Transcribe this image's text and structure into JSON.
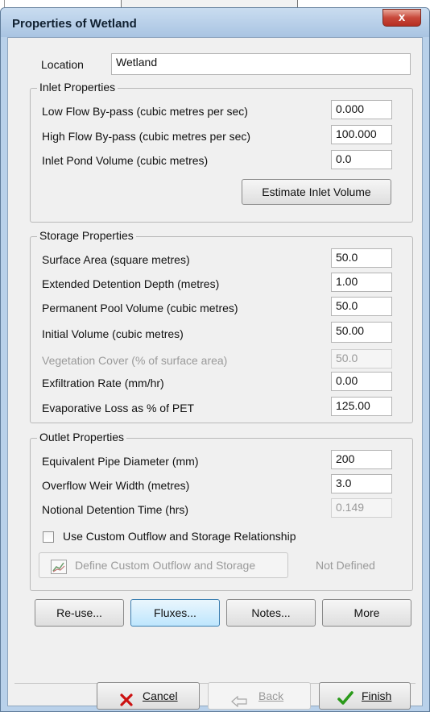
{
  "window": {
    "title": "Properties of Wetland",
    "close_label": "x"
  },
  "location": {
    "label": "Location",
    "value": "Wetland"
  },
  "inlet": {
    "legend": "Inlet Properties",
    "rows": [
      {
        "label": "Low Flow By-pass (cubic metres per sec)",
        "value": "0.000"
      },
      {
        "label": "High Flow By-pass (cubic metres per sec)",
        "value": "100.000"
      },
      {
        "label": "Inlet Pond Volume (cubic metres)",
        "value": "0.0"
      }
    ],
    "estimate_button": "Estimate Inlet Volume"
  },
  "storage": {
    "legend": "Storage Properties",
    "rows": [
      {
        "label": "Surface Area (square metres)",
        "value": "50.0"
      },
      {
        "label": "Extended Detention Depth (metres)",
        "value": "1.00"
      },
      {
        "label": "Permanent Pool Volume (cubic metres)",
        "value": "50.0"
      },
      {
        "label": "Initial Volume (cubic metres)",
        "value": "50.00"
      },
      {
        "label": "Vegetation Cover (% of surface area)",
        "value": "50.0"
      },
      {
        "label": "Exfiltration Rate (mm/hr)",
        "value": "0.00"
      },
      {
        "label": "Evaporative Loss as % of PET",
        "value": "125.00"
      }
    ]
  },
  "outlet": {
    "legend": "Outlet Properties",
    "rows": [
      {
        "label": "Equivalent Pipe Diameter (mm)",
        "value": "200"
      },
      {
        "label": "Overflow Weir Width (metres)",
        "value": "3.0"
      },
      {
        "label": "Notional Detention Time (hrs)",
        "value": "0.149"
      }
    ],
    "custom_checkbox_label": "Use Custom Outflow and Storage Relationship",
    "define_button": "Define Custom Outflow and Storage",
    "status": "Not Defined"
  },
  "actions": {
    "reuse": "Re-use...",
    "fluxes": "Fluxes...",
    "notes": "Notes...",
    "more": "More"
  },
  "nav": {
    "cancel": "Cancel",
    "back": "Back",
    "finish": "Finish"
  },
  "colors": {
    "accent": "#3c7fb1",
    "cancel_icon": "#cc1111",
    "finish_icon": "#2a9a1a",
    "close": "#c8483a"
  }
}
